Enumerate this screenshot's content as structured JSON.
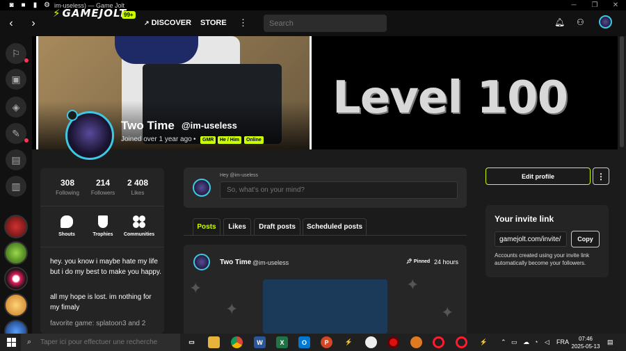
{
  "window": {
    "title": "im-useless) — Game Jolt"
  },
  "nav": {
    "logo": "GAMEJOLT",
    "badge": "99+",
    "discover": "DISCOVER",
    "store": "STORE",
    "search_placeholder": "Search"
  },
  "banner": {
    "level_text": "Level 100"
  },
  "profile": {
    "display_name": "Two Time",
    "handle": "@im-useless",
    "joined": "Joined over 1 year ago",
    "separator": "•",
    "tags": [
      "GMR",
      "He / Him",
      "Online"
    ]
  },
  "stats": [
    {
      "num": "308",
      "label": "Following"
    },
    {
      "num": "214",
      "label": "Followers"
    },
    {
      "num": "2 408",
      "label": "Likes"
    }
  ],
  "quicklinks": [
    "Shouts",
    "Trophies",
    "Communities"
  ],
  "bio": [
    "hey. you know i maybe hate my life but i do my best to make you happy.",
    "all my hope is lost. im nothing for my fimaly",
    "favorite game: splatoon3 and 2"
  ],
  "composer": {
    "greeting": "Hey @im-useless",
    "placeholder": "So, what's on your mind?"
  },
  "tabs": [
    "Posts",
    "Likes",
    "Draft posts",
    "Scheduled posts"
  ],
  "post": {
    "name": "Two Time",
    "handle": "@im-useless",
    "pinned": "Pinned",
    "time": "24 hours"
  },
  "right": {
    "edit_profile": "Edit profile",
    "more": "⋮",
    "invite_title": "Your invite link",
    "invite_link": "gamejolt.com/invite/",
    "copy": "Copy",
    "invite_desc": "Accounts created using your invite link automatically become your followers."
  },
  "taskbar": {
    "search_placeholder": "Taper ici pour effectuer une recherche",
    "lang": "FRA",
    "time": "07:46",
    "date": "2025-05-13"
  },
  "colors": {
    "accent": "#ccff00",
    "avatar_ring": "#3ec8e6",
    "notif_dot": "#ff3355"
  }
}
